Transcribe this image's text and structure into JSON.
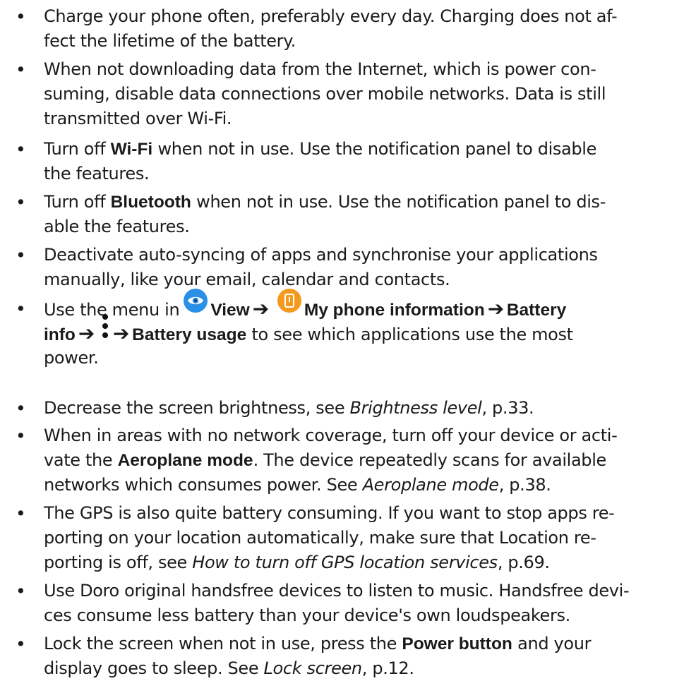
{
  "bullet_char": "•",
  "items": [
    {
      "lines": [
        "Charge your phone often, preferably every day. Charging does not af-",
        "fect the lifetime of the battery."
      ]
    },
    {
      "lines": [
        "When not downloading data from the Internet, which is power con-",
        "suming, disable data connections over mobile networks. Data is still",
        "transmitted over Wi-Fi."
      ]
    },
    {
      "pre": "Turn off ",
      "bold": "Wi-Fi",
      "post": " when not in use. Use the notification panel to disable",
      "line2": "the features."
    },
    {
      "pre": "Turn off ",
      "bold": "Bluetooth",
      "post": " when not in use. Use the notification panel to dis-",
      "line2": "able the features."
    },
    {
      "lines": [
        "Deactivate auto-syncing of apps and synchronise your applications",
        "manually, like your email, calendar and contacts."
      ]
    },
    {
      "l1_pre": "Use the menu in",
      "view": "View",
      "arrow": "➔",
      "myphone": "My phone information",
      "battery": "Battery",
      "info": "info",
      "usage": "Battery usage",
      "l2_post": " to see which applications use the most",
      "l3": "power.",
      "icons": {
        "view": "eye-icon",
        "myphone": "phone-icon",
        "menu": "more-vert-icon"
      },
      "colors": {
        "view": "#2a8fe6",
        "myphone": "#f39a1e"
      }
    },
    {
      "pre": "Decrease the screen brightness, see ",
      "ref": "Brightness level",
      "post": ", p.33."
    },
    {
      "l1": "When in areas with no network coverage, turn off your device or acti-",
      "l2_pre": "vate the ",
      "l2_bold": "Aeroplane mode",
      "l2_post": ". The device repeatedly scans for available",
      "l3_pre": "networks which consumes power. See ",
      "l3_ref": "Aeroplane mode",
      "l3_post": ", p.38."
    },
    {
      "l1": "The GPS is also quite battery consuming. If you want to stop apps re-",
      "l2": "porting on your location automatically, make sure that Location re-",
      "l3_pre": "porting is off, see ",
      "l3_ref": "How to turn off GPS location services",
      "l3_post": ", p.69."
    },
    {
      "lines": [
        "Use Doro original handsfree devices to listen to music. Handsfree devi-",
        "ces consume less battery than your device's own loudspeakers."
      ]
    },
    {
      "l1_pre": "Lock the screen when not in use, press the ",
      "l1_bold": "Power button",
      "l1_post": " and your",
      "l2_pre": "display goes to sleep. See ",
      "l2_ref": "Lock screen",
      "l2_post": ", p.12."
    }
  ]
}
